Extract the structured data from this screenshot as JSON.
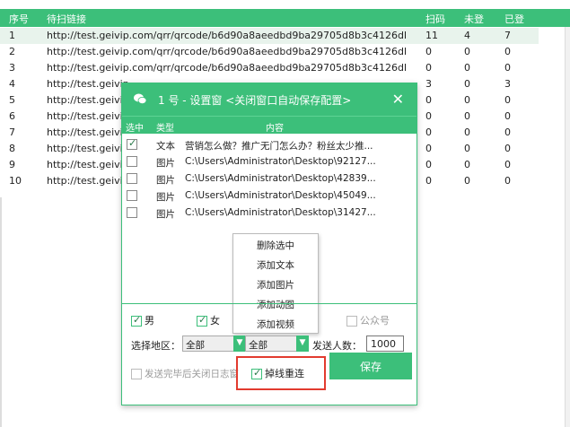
{
  "table": {
    "headers": {
      "no": "序号",
      "url": "待扫链接",
      "scanned": "扫码",
      "not_logged": "未登",
      "logged": "已登"
    },
    "rows": [
      {
        "no": "1",
        "url": "http://test.geivip.com/qrr/qrcode/b6d90a8aeedbd9ba29705d8b3c4126db_1",
        "scanned": "11",
        "not_logged": "4",
        "logged": "7"
      },
      {
        "no": "2",
        "url": "http://test.geivip.com/qrr/qrcode/b6d90a8aeedbd9ba29705d8b3c4126db_2",
        "scanned": "0",
        "not_logged": "0",
        "logged": "0"
      },
      {
        "no": "3",
        "url": "http://test.geivip.com/qrr/qrcode/b6d90a8aeedbd9ba29705d8b3c4126db_3",
        "scanned": "0",
        "not_logged": "0",
        "logged": "0"
      },
      {
        "no": "4",
        "url": "http://test.geivip",
        "scanned": "3",
        "not_logged": "0",
        "logged": "3"
      },
      {
        "no": "5",
        "url": "http://test.geivip",
        "scanned": "0",
        "not_logged": "0",
        "logged": "0"
      },
      {
        "no": "6",
        "url": "http://test.geivip",
        "scanned": "0",
        "not_logged": "0",
        "logged": "0"
      },
      {
        "no": "7",
        "url": "http://test.geivip",
        "scanned": "0",
        "not_logged": "0",
        "logged": "0"
      },
      {
        "no": "8",
        "url": "http://test.geivip",
        "scanned": "0",
        "not_logged": "0",
        "logged": "0"
      },
      {
        "no": "9",
        "url": "http://test.geivip",
        "scanned": "0",
        "not_logged": "0",
        "logged": "0"
      },
      {
        "no": "10",
        "url": "http://test.geivip",
        "scanned": "0",
        "not_logged": "0",
        "logged": "0"
      }
    ]
  },
  "dialog": {
    "title": "1 号 - 设置窗 <关闭窗口自动保存配置>",
    "close": "✕",
    "list_headers": {
      "select": "选中",
      "type": "类型",
      "content": "内容"
    },
    "items": [
      {
        "checked": true,
        "type": "文本",
        "content": "营销怎么做？推广无门怎么办？粉丝太少推..."
      },
      {
        "checked": false,
        "type": "图片",
        "content": "C:\\Users\\Administrator\\Desktop\\92127..."
      },
      {
        "checked": false,
        "type": "图片",
        "content": "C:\\Users\\Administrator\\Desktop\\42839..."
      },
      {
        "checked": false,
        "type": "图片",
        "content": "C:\\Users\\Administrator\\Desktop\\45049..."
      },
      {
        "checked": false,
        "type": "图片",
        "content": "C:\\Users\\Administrator\\Desktop\\31427..."
      }
    ],
    "context_menu": [
      "删除选中",
      "添加文本",
      "添加图片",
      "添加动图",
      "添加视频"
    ],
    "gender_male": "男",
    "gender_female": "女",
    "public_account": "公众号",
    "region_label": "选择地区：",
    "region1": "全部",
    "region2": "全部",
    "send_label": "发送人数：",
    "send_count": "1000",
    "close_log_label": "发送完毕后关闭日志窗",
    "dropout_label": "掉线重连",
    "save_label": "保存"
  },
  "colors": {
    "accent": "#3cbf7a",
    "highlight": "#e23b2f"
  }
}
